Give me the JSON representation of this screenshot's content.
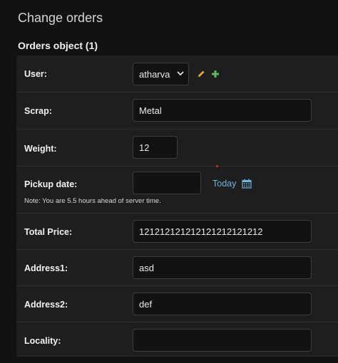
{
  "page": {
    "title": "Change orders",
    "object_title": "Orders object (1)"
  },
  "fields": {
    "user": {
      "label": "User:",
      "value": "atharva",
      "edit_icon": "pencil-icon",
      "add_icon": "plus-icon"
    },
    "scrap": {
      "label": "Scrap:",
      "value": "Metal"
    },
    "weight": {
      "label": "Weight:",
      "value": "12"
    },
    "pickup_date": {
      "label": "Pickup date:",
      "value": "",
      "today_link": "Today",
      "calendar_icon": "calendar-icon",
      "note": "Note: You are 5.5 hours ahead of server time."
    },
    "total_price": {
      "label": "Total Price:",
      "value": "121212121212121212121212"
    },
    "address1": {
      "label": "Address1:",
      "value": "asd"
    },
    "address2": {
      "label": "Address2:",
      "value": "def"
    },
    "locality": {
      "label": "Locality:",
      "value": ""
    }
  },
  "colors": {
    "background": "#121212",
    "row_background": "#1e1e1e",
    "link": "#6fb3e0",
    "edit_icon": "#e0a82e",
    "add_icon": "#5cb85c",
    "indicator": "#d32f2f"
  }
}
